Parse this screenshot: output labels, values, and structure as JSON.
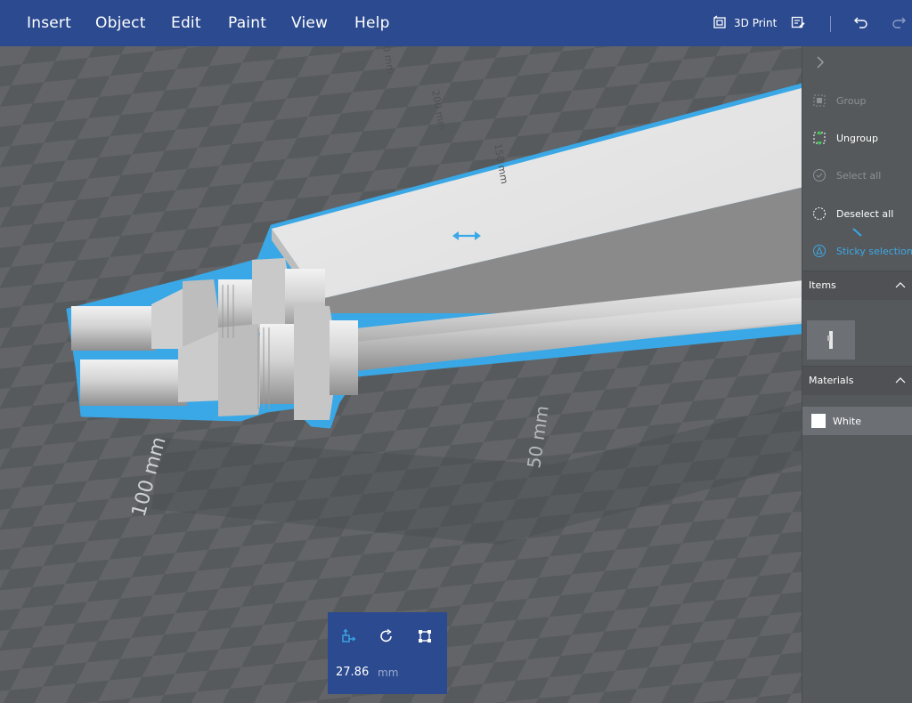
{
  "menu": [
    "Insert",
    "Object",
    "Edit",
    "Paint",
    "View",
    "Help"
  ],
  "toolbar": {
    "print_label": "3D Print",
    "print_icon": "print-3d-icon",
    "checklist_icon": "checklist-icon",
    "undo_icon": "undo-icon",
    "redo_icon": "redo-icon"
  },
  "scene": {
    "rulers": [
      "100 mm",
      "50 mm",
      "200 mm",
      "150 mm",
      "0 mm"
    ]
  },
  "panel": {
    "collapse_icon": "chevron-right-icon",
    "group_label": "Group",
    "ungroup_label": "Ungroup",
    "select_all_label": "Select all",
    "deselect_all_label": "Deselect all",
    "sticky_label": "Sticky selection",
    "items_title": "Items",
    "materials_title": "Materials",
    "material_name": "White",
    "material_color": "#ffffff"
  },
  "transform": {
    "value": "27.86",
    "unit": "mm",
    "icons": [
      "move-icon",
      "rotate-icon",
      "scale-icon"
    ]
  },
  "colors": {
    "menubar": "#2b4a8f",
    "accent": "#3aa8e6",
    "grid_dark": "#5a5d60",
    "grid_light": "#6a6d70"
  }
}
